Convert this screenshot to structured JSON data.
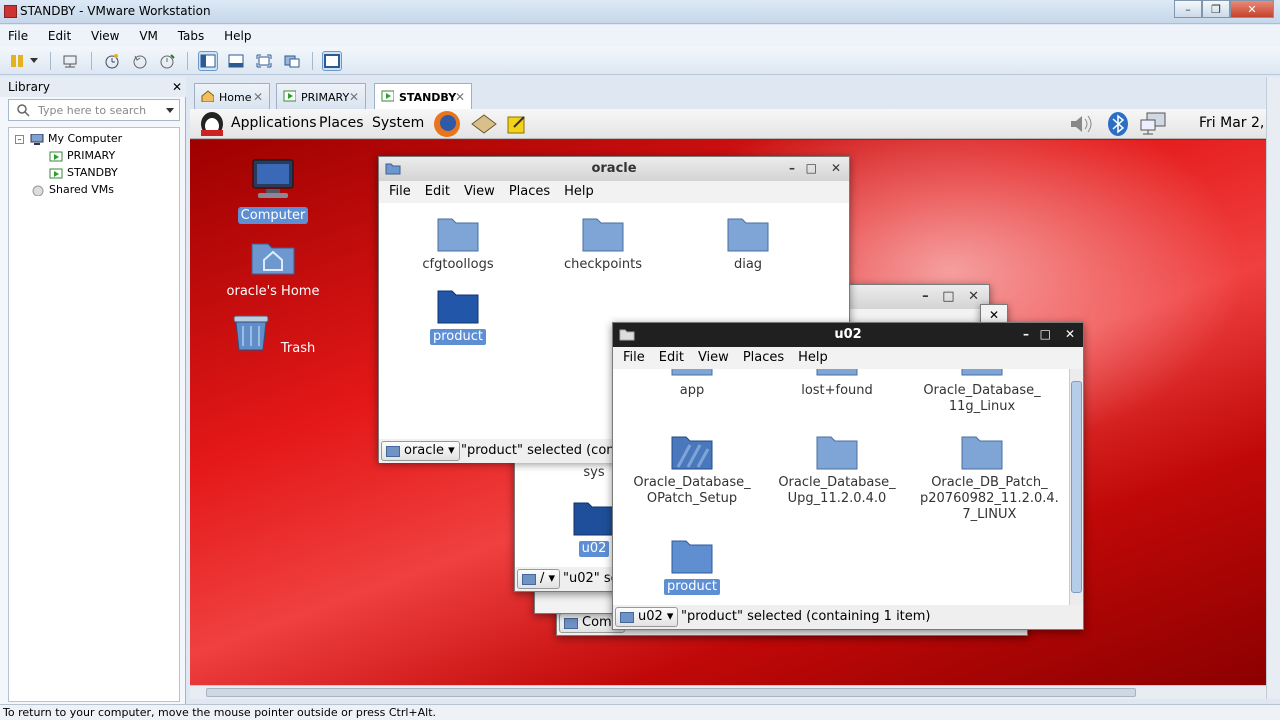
{
  "window": {
    "title": "STANDBY - VMware Workstation"
  },
  "menubar": [
    "File",
    "Edit",
    "View",
    "VM",
    "Tabs",
    "Help"
  ],
  "library": {
    "title": "Library",
    "search_placeholder": "Type here to search",
    "tree": {
      "root": "My Computer",
      "vms": [
        "PRIMARY",
        "STANDBY"
      ],
      "shared": "Shared VMs"
    }
  },
  "tabs": [
    {
      "label": "Home"
    },
    {
      "label": "PRIMARY"
    },
    {
      "label": "STANDBY"
    }
  ],
  "guest_panel": {
    "menus": [
      "Applications",
      "Places",
      "System"
    ],
    "clock": "Fri Mar  2,"
  },
  "desktop_icons": [
    "Computer",
    "oracle's Home",
    "Trash"
  ],
  "win_oracle": {
    "title": "oracle",
    "menus": [
      "File",
      "Edit",
      "View",
      "Places",
      "Help"
    ],
    "folders": [
      "cfgtoollogs",
      "checkpoints",
      "diag",
      "product"
    ],
    "location": "oracle",
    "status": "\"product\" selected (conta"
  },
  "win_root": {
    "partial_label": "sys",
    "folder": "u02",
    "location": "/",
    "status": "\"u02\" se"
  },
  "win_computer": {
    "location": "Comp"
  },
  "win_u02": {
    "title": "u02",
    "menus": [
      "File",
      "Edit",
      "View",
      "Places",
      "Help"
    ],
    "folders": [
      "app",
      "lost+found",
      "Oracle_Database_\n11g_Linux",
      "Oracle_Database_\nOPatch_Setup",
      "Oracle_Database_\nUpg_11.2.0.4.0",
      "Oracle_DB_Patch_\np20760982_11.2.0.4.\n7_LINUX",
      "product"
    ],
    "location": "u02",
    "status": "\"product\" selected (containing 1 item)"
  },
  "statusbar": "To return to your computer, move the mouse pointer outside or press Ctrl+Alt."
}
